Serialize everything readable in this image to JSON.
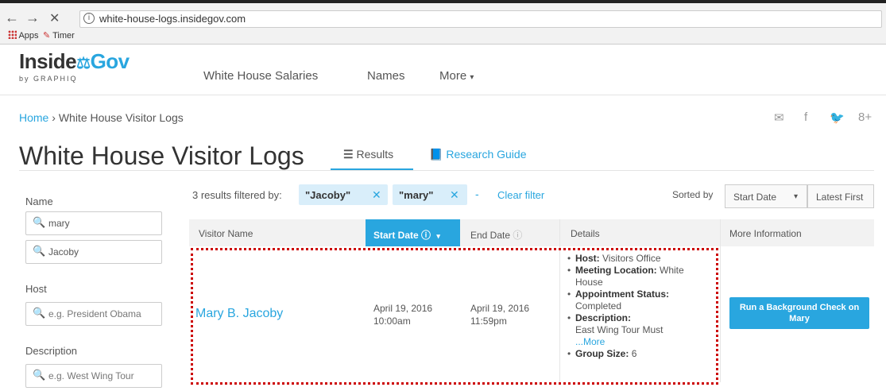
{
  "browser": {
    "back": "←",
    "forward": "→",
    "close": "✕",
    "url": "white-house-logs.insidegov.com",
    "bookmarks": [
      "Apps",
      "Timer"
    ]
  },
  "site": {
    "logo_main": "Inside",
    "logo_gov": "Gov",
    "logo_sub": "by GRAPHIQ",
    "nav": [
      "White House Salaries",
      "Names",
      "More"
    ]
  },
  "breadcrumb": {
    "home": "Home",
    "sep": "›",
    "current": "White House Visitor Logs"
  },
  "page": {
    "title": "White House Visitor Logs",
    "tab_results": "Results",
    "tab_research": "Research Guide"
  },
  "sidebar": {
    "name_label": "Name",
    "name_values": [
      "mary",
      "Jacoby"
    ],
    "host_label": "Host",
    "host_placeholder": "e.g. President Obama",
    "description_label": "Description",
    "description_placeholder": "e.g. West Wing Tour"
  },
  "filters": {
    "count_text": "3 results filtered by:",
    "chips": [
      "\"Jacoby\"",
      "\"mary\""
    ],
    "clear": "Clear filter",
    "sorted_by": "Sorted by",
    "sort_field": "Start Date",
    "sort_order": "Latest First"
  },
  "table": {
    "headers": [
      "Visitor Name",
      "Start Date",
      "End Date",
      "Details",
      "More Information"
    ],
    "row": {
      "visitor": "Mary B. Jacoby",
      "start_date": "April 19, 2016",
      "start_time": "10:00am",
      "end_date": "April 19, 2016",
      "end_time": "11:59pm",
      "host_label": "Host:",
      "host_value": "Visitors Office",
      "location_label": "Meeting Location:",
      "location_value": "White",
      "location_value2": "House",
      "status_label": "Appointment Status:",
      "status_value": "Completed",
      "description_label": "Description:",
      "description_value": "East Wing Tour Must",
      "more": "...More",
      "group_label": "Group Size:",
      "group_value": "6",
      "action": "Run a Background Check on Mary"
    }
  },
  "colors": {
    "accent": "#29a6df",
    "highlight": "#cc0000"
  }
}
